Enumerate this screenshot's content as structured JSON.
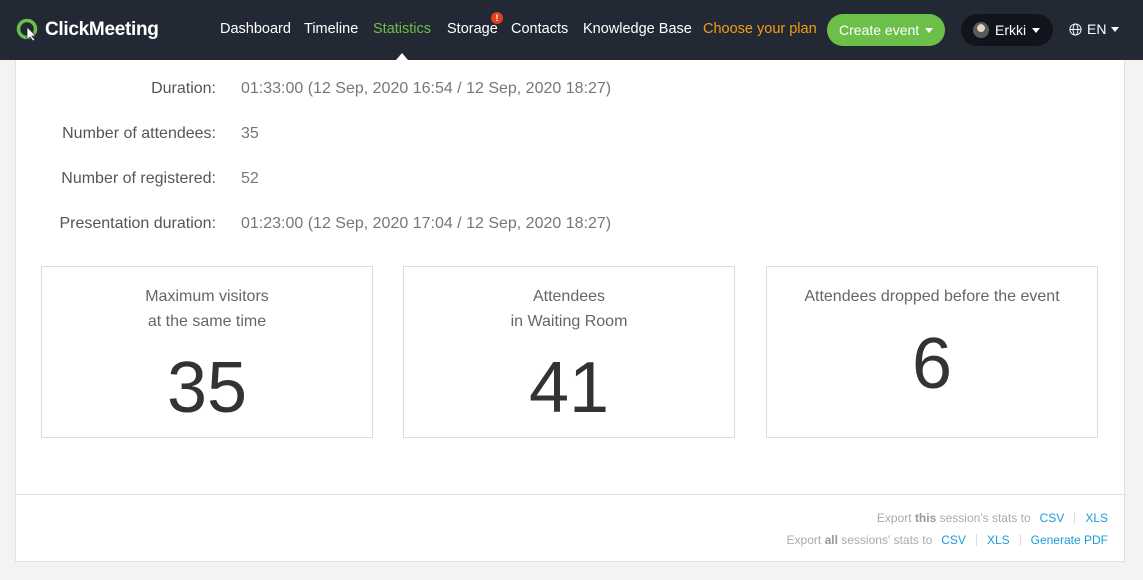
{
  "header": {
    "logo_text": "ClickMeeting",
    "nav": [
      {
        "label": "Dashboard"
      },
      {
        "label": "Timeline"
      },
      {
        "label": "Statistics"
      },
      {
        "label": "Storage"
      },
      {
        "label": "Contacts"
      },
      {
        "label": "Knowledge Base"
      },
      {
        "label": "Choose your plan"
      }
    ],
    "storage_badge": "!",
    "create_event_label": "Create event",
    "user_name": "Erkki",
    "language": "EN"
  },
  "session": {
    "rows": [
      {
        "label": "Duration:",
        "value": "01:33:00 (12 Sep, 2020 16:54 / 12 Sep, 2020 18:27)"
      },
      {
        "label": "Number of attendees:",
        "value": "35"
      },
      {
        "label": "Number of registered:",
        "value": "52"
      },
      {
        "label": "Presentation duration:",
        "value": "01:23:00 (12 Sep, 2020 17:04 / 12 Sep, 2020 18:27)"
      }
    ]
  },
  "cards": [
    {
      "line1": "Maximum visitors",
      "line2": "at the same time",
      "value": "35"
    },
    {
      "line1": "Attendees",
      "line2": "in Waiting Room",
      "value": "41"
    },
    {
      "line1": "Attendees dropped before the event",
      "line2": "",
      "value": "6"
    }
  ],
  "export": {
    "this_prefix": "Export",
    "this_bold": "this",
    "this_suffix": "session's stats to",
    "all_prefix": "Export",
    "all_bold": "all",
    "all_suffix": "sessions' stats to",
    "csv": "CSV",
    "xls": "XLS",
    "pdf": "Generate PDF"
  },
  "colors": {
    "topbar": "#232934",
    "accent_green": "#6cc04a",
    "plan_orange": "#f39c12",
    "link_blue": "#1a9bd7"
  }
}
